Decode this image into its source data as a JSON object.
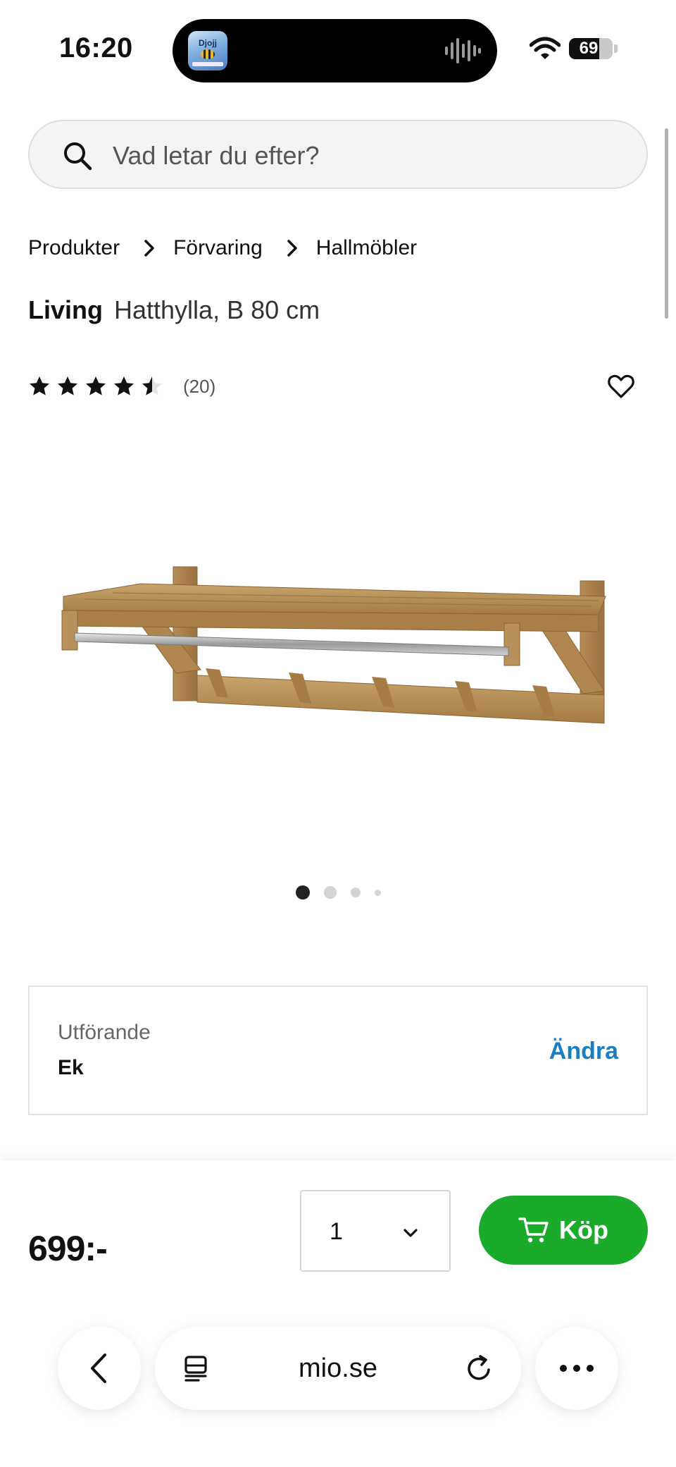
{
  "status_bar": {
    "time": "16:20",
    "app_name": "Djojj",
    "battery": "69",
    "battery_level": 0.69
  },
  "search": {
    "placeholder": "Vad letar du efter?"
  },
  "breadcrumb": [
    {
      "label": "Produkter"
    },
    {
      "label": "Förvaring"
    },
    {
      "label": "Hallmöbler"
    }
  ],
  "product": {
    "brand": "Living",
    "name": "Hatthylla, B 80 cm",
    "rating": 4.5,
    "rating_max": 5,
    "review_count": "(20)",
    "image_icon": "coat-rack-image"
  },
  "carousel": {
    "total": 4,
    "active_index": 0
  },
  "variant": {
    "label": "Utförande",
    "value": "Ek",
    "change_label": "Ändra"
  },
  "purchase": {
    "price": "699:-",
    "quantity": "1",
    "buy_label": "Köp"
  },
  "browser": {
    "url": "mio.se"
  },
  "colors": {
    "accent_green": "#1aab2b",
    "link_blue": "#1a7fc1",
    "text_dark": "#111111"
  }
}
